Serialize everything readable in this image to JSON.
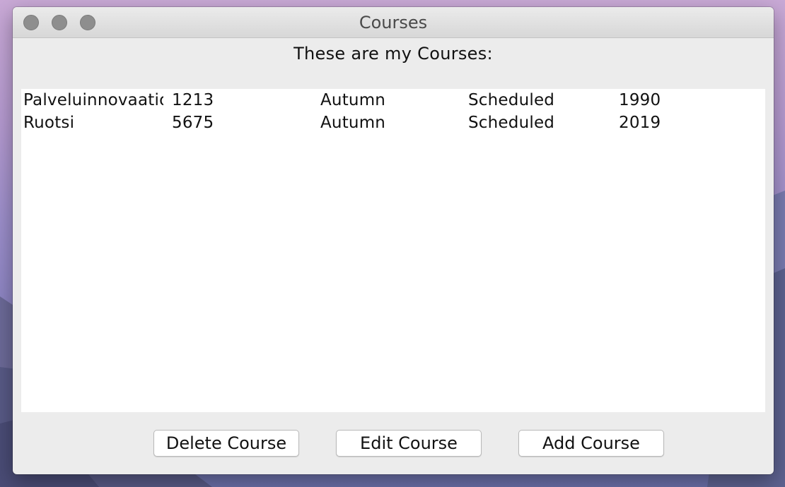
{
  "window": {
    "title": "Courses"
  },
  "heading": "These are my Courses:",
  "courses": [
    {
      "name": "Palveluinnovaatio",
      "code": "1213",
      "term": "Autumn",
      "status": "Scheduled",
      "year": "1990"
    },
    {
      "name": "Ruotsi",
      "code": "5675",
      "term": "Autumn",
      "status": "Scheduled",
      "year": "2019"
    }
  ],
  "buttons": {
    "delete": "Delete Course",
    "edit": "Edit Course",
    "add": "Add Course"
  }
}
